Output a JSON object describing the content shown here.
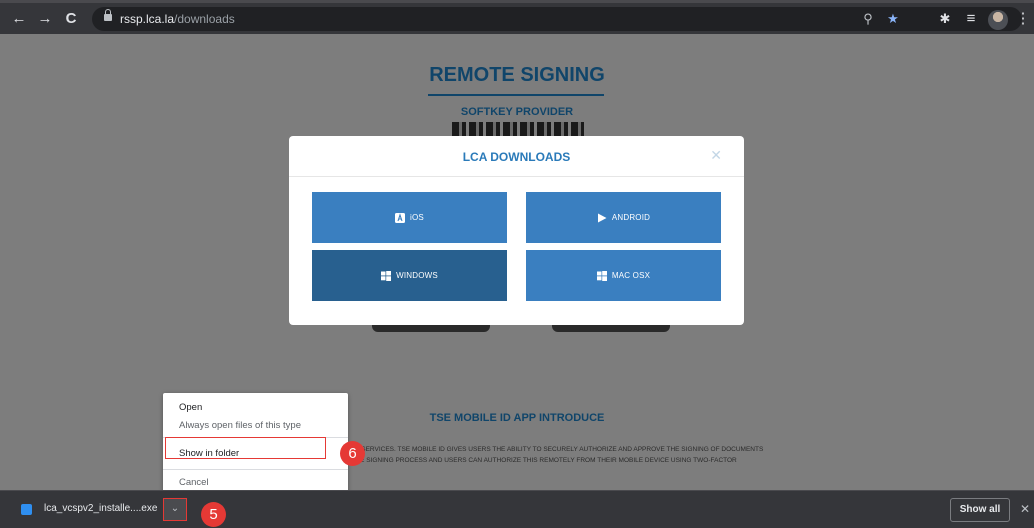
{
  "browser": {
    "nav": {
      "back": "←",
      "forward": "→",
      "reload": "C"
    },
    "url_host": "rssp.lca.la",
    "url_path": "/downloads",
    "icons": {
      "zoom": "zoom-icon",
      "bookmark": "star-icon",
      "extensions": "puzzle-icon",
      "reading_list": "reading-list-icon",
      "menu": "kebab-menu-icon"
    },
    "glyphs": {
      "zoom": "⚲",
      "star": "★",
      "puzzle": "✱",
      "list": "≡",
      "kebab": "⋮"
    }
  },
  "page_background": {
    "title": "REMOTE SIGNING",
    "subtitle": "SOFTKEY PROVIDER",
    "section_heading": "TSE MOBILE ID APP INTRODUCE",
    "body_line_1": "LINE SERVICES. TSE MOBILE ID GIVES USERS THE ABILITY TO SECURELY AUTHORIZE AND APPROVE THE SIGNING OF DOCUMENTS",
    "body_line_2": "R THE SIGNING PROCESS AND USERS CAN AUTHORIZE THIS REMOTELY FROM THEIR MOBILE DEVICE USING TWO-FACTOR"
  },
  "modal": {
    "title": "LCA DOWNLOADS",
    "close": "✕",
    "buttons": [
      {
        "label": "iOS",
        "icon": "app-store-icon"
      },
      {
        "label": "ANDROID",
        "icon": "play-store-icon"
      },
      {
        "label": "WINDOWS",
        "icon": "windows-icon"
      },
      {
        "label": "MAC OSX",
        "icon": "windows-icon"
      }
    ]
  },
  "context_menu": {
    "items": [
      {
        "label": "Open"
      },
      {
        "label": "Always open files of this type"
      },
      {
        "label": "Show in folder"
      },
      {
        "label": "Cancel"
      }
    ]
  },
  "badges": {
    "step_5": "5",
    "step_6": "6"
  },
  "download_bar": {
    "file_name": "lca_vcspv2_installe....exe",
    "chevron": "⌄",
    "show_all": "Show all",
    "close": "✕"
  },
  "colors": {
    "accent": "#3a7fc0",
    "highlight": "#e53935",
    "title": "#2a7ab9"
  }
}
